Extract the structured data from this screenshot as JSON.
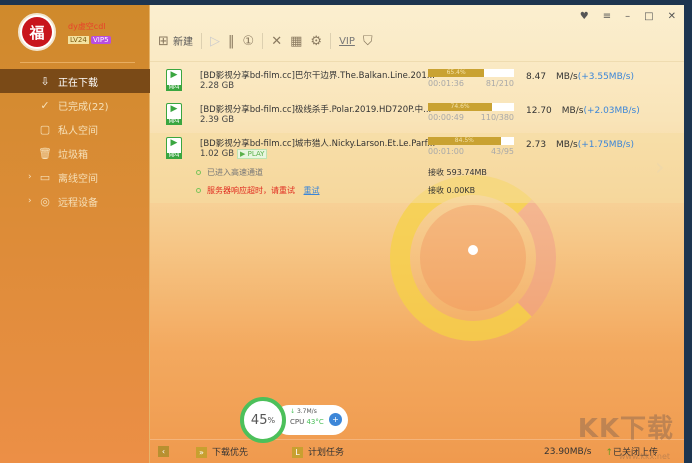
{
  "user": {
    "name": "dy虚空cdl",
    "level": "LV24",
    "vip": "VIP5"
  },
  "sidebar": {
    "items": [
      {
        "label": "正在下载",
        "icon": "download-icon",
        "active": true
      },
      {
        "label": "已完成(22)",
        "icon": "check-circle-icon"
      },
      {
        "label": "私人空间",
        "icon": "lock-icon"
      },
      {
        "label": "垃圾箱",
        "icon": "trash-icon"
      },
      {
        "label": "离线空间",
        "icon": "cloud-icon",
        "expandable": true
      },
      {
        "label": "远程设备",
        "icon": "remote-icon",
        "expandable": true
      }
    ]
  },
  "toolbar": {
    "new_label": "新建",
    "vip_label": "VIP"
  },
  "downloads": [
    {
      "name": "[BD影视分享bd-film.cc]巴尔干边界.The.Balkan.Line.201...",
      "size": "2.28 GB",
      "percent_label": "65.4%",
      "progress": 65.4,
      "time": "00:01:36",
      "count": "81/210",
      "speed": "8.47",
      "unit": "MB/s",
      "boost": "(+3.55MB/s)",
      "type": "MP4"
    },
    {
      "name": "[BD影视分享bd-film.cc]极线杀手.Polar.2019.HD720P.中...",
      "size": "2.39 GB",
      "percent_label": "74.6%",
      "progress": 74.6,
      "time": "00:00:49",
      "count": "110/380",
      "speed": "12.70",
      "unit": "MB/s",
      "boost": "(+2.03MB/s)",
      "type": "MP4"
    },
    {
      "name": "[BD影视分享bd-film.cc]城市猎人.Nicky.Larson.Et.Le.Parf...",
      "size": "1.02 GB",
      "percent_label": "84.5%",
      "progress": 84.5,
      "time": "00:01:00",
      "count": "43/95",
      "speed": "2.73",
      "unit": "MB/s",
      "boost": "(+1.75MB/s)",
      "type": "MP4",
      "play": "PLAY",
      "status1": "已进入高速通道",
      "recv1": "接收 593.74MB",
      "status2": "服务器响应超时，请重试",
      "retry": "重试",
      "recv2": "接收 0.00KB"
    }
  ],
  "widget": {
    "percent": "45",
    "unit": "%",
    "speed": "3.7M/s",
    "cpu_label": "CPU",
    "cpu_temp": "43°C"
  },
  "bottom": {
    "priority": "下载优先",
    "schedule": "计划任务",
    "total_speed": "23.90MB/s",
    "upload": "已关闭上传"
  },
  "watermark": {
    "logo": "KK下载",
    "url": "www.kkx.net"
  }
}
